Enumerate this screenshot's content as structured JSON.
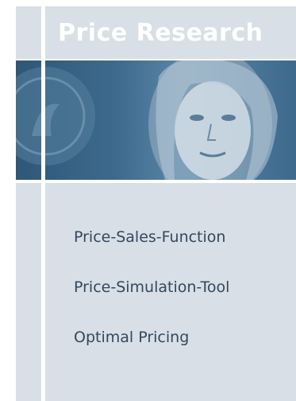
{
  "header": {
    "title": "Price Research"
  },
  "hero": {
    "image_subject": "woman-portrait-with-coin"
  },
  "menu": {
    "items": [
      {
        "label": "Price-Sales-Function"
      },
      {
        "label": "Price-Simulation-Tool"
      },
      {
        "label": "Optimal Pricing"
      }
    ]
  },
  "colors": {
    "panel": "#d8dfe6",
    "photo_tint": "#3d6a8c",
    "title_text": "#ffffff",
    "link_text": "#33485e"
  }
}
